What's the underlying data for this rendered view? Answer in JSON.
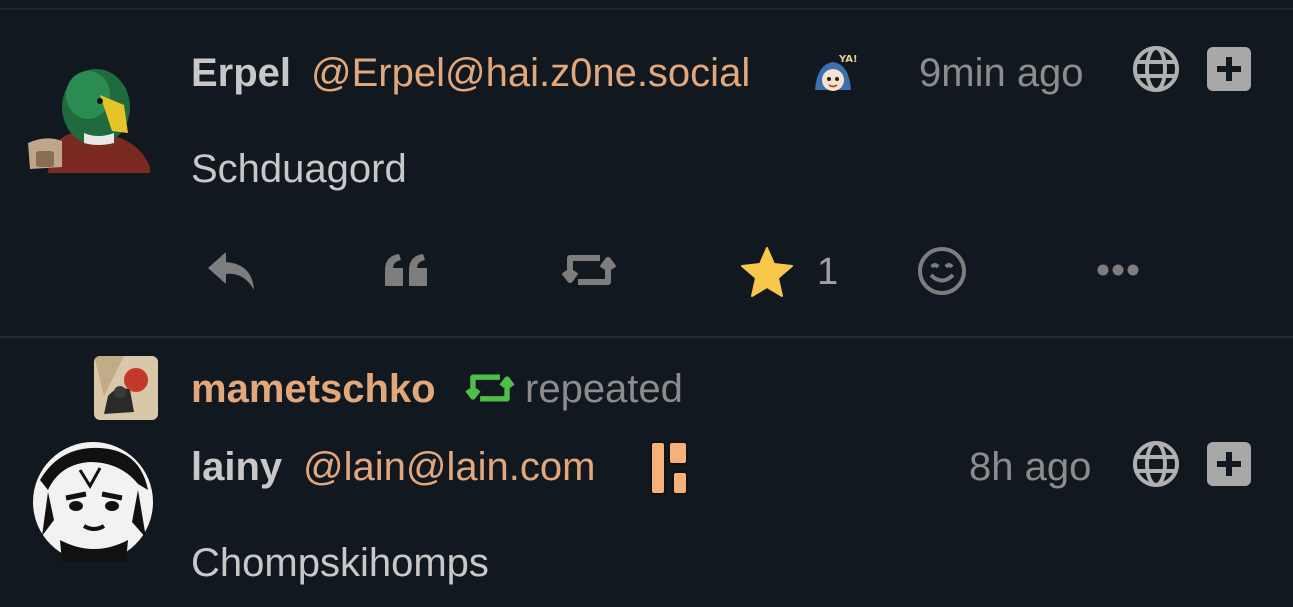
{
  "posts": [
    {
      "name": "Erpel",
      "handle": "@Erpel@hai.z0ne.social",
      "time": "9min ago",
      "content": "Schduagord",
      "favorite_count": "1"
    },
    {
      "repeated_by": "mametschko",
      "repeated_label": "repeated",
      "name": "lainy",
      "handle": "@lain@lain.com",
      "time": "8h ago",
      "content": "Chompskihomps"
    }
  ],
  "colors": {
    "background": "#121820",
    "accent": "#e2a77a",
    "star": "#f7c84a",
    "repeat_green": "#4fbf4a"
  }
}
